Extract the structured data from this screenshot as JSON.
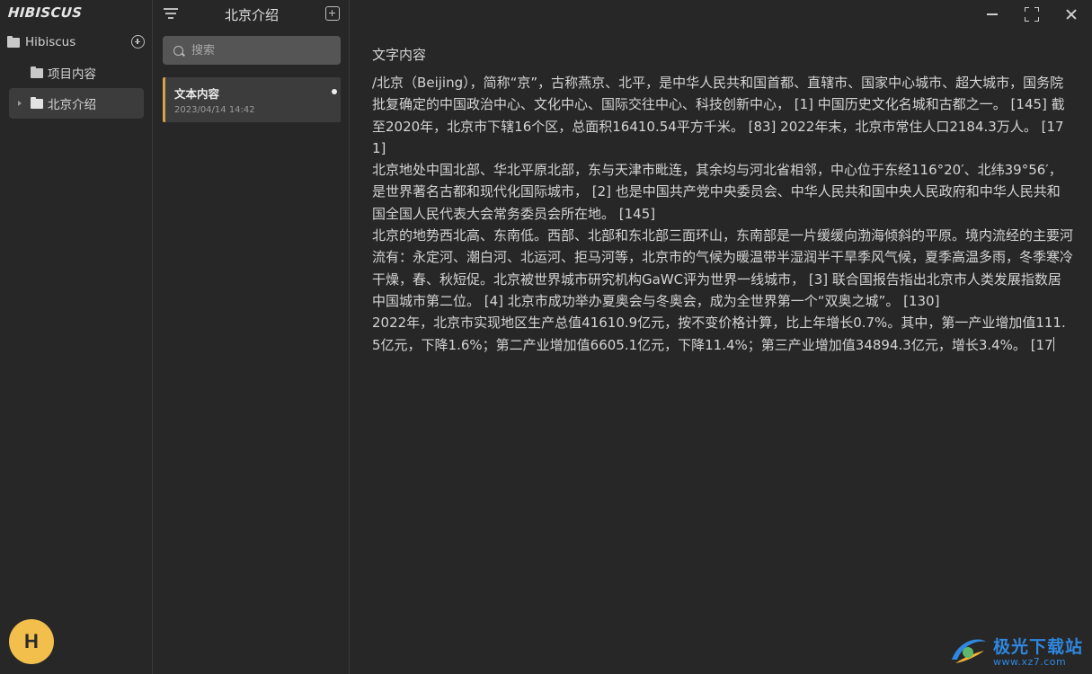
{
  "app": {
    "brand": "HIBISCUS",
    "avatar_letter": "H"
  },
  "sidebar": {
    "root_label": "Hibiscus",
    "items": [
      {
        "label": "项目内容",
        "selected": false
      },
      {
        "label": "北京介绍",
        "selected": true
      }
    ]
  },
  "notes": {
    "title": "北京介绍",
    "search_placeholder": "搜索",
    "list": [
      {
        "title": "文本内容",
        "date": "2023/04/14 14:42",
        "unsaved": true
      }
    ]
  },
  "editor": {
    "title": "文字内容",
    "paragraphs": [
      "/北京（Beijing），简称“京”，古称燕京、北平，是中华人民共和国首都、直辖市、国家中心城市、超大城市，国务院批复确定的中国政治中心、文化中心、国际交往中心、科技创新中心， [1] 中国历史文化名城和古都之一。 [145] 截至2020年，北京市下辖16个区，总面积16410.54平方千米。 [83] 2022年末，北京市常住人口2184.3万人。 [171]",
      "北京地处中国北部、华北平原北部，东与天津市毗连，其余均与河北省相邻，中心位于东经116°20′、北纬39°56′，是世界著名古都和现代化国际城市， [2] 也是中国共产党中央委员会、中华人民共和国中央人民政府和中华人民共和国全国人民代表大会常务委员会所在地。 [145]",
      "北京的地势西北高、东南低。西部、北部和东北部三面环山，东南部是一片缓缓向渤海倾斜的平原。境内流经的主要河流有：永定河、潮白河、北运河、拒马河等，北京市的气候为暖温带半湿润半干旱季风气候，夏季高温多雨，冬季寒冷干燥，春、秋短促。北京被世界城市研究机构GaWC评为世界一线城市， [3] 联合国报告指出北京市人类发展指数居中国城市第二位。 [4] 北京市成功举办夏奥会与冬奥会，成为全世界第一个“双奥之城”。 [130]",
      "2022年，北京市实现地区生产总值41610.9亿元，按不变价格计算，比上年增长0.7%。其中，第一产业增加值111.5亿元，下降1.6%；第二产业增加值6605.1亿元，下降11.4%；第三产业增加值34894.3亿元，增长3.4%。 [17"
    ]
  },
  "watermark": {
    "name": "极光下载站",
    "url": "www.xz7.com"
  },
  "colors": {
    "accent": "#d7a24a",
    "avatar": "#f2be4c",
    "bg": "#272727",
    "selected": "#3c3c3c"
  }
}
